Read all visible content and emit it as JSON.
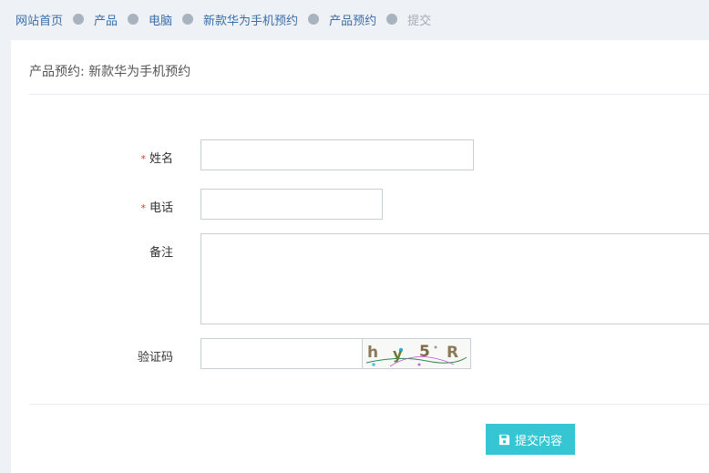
{
  "breadcrumb": {
    "items": [
      "网站首页",
      "产品",
      "电脑",
      "新款华为手机预约",
      "产品预约",
      "提交"
    ]
  },
  "page_title": "产品预约: 新款华为手机预约",
  "form": {
    "name_label": "姓名",
    "phone_label": "电话",
    "notes_label": "备注",
    "captcha_label": "验证码",
    "required_mark": "*",
    "name_value": "",
    "phone_value": "",
    "notes_value": "",
    "captcha_value": "",
    "captcha_text": "hy5R",
    "submit_label": "提交内容",
    "submit_icon": "save-icon"
  },
  "colors": {
    "accent": "#36c6d3",
    "link": "#3b6ea8",
    "required": "#e33333",
    "page_bg": "#eef1f6"
  }
}
